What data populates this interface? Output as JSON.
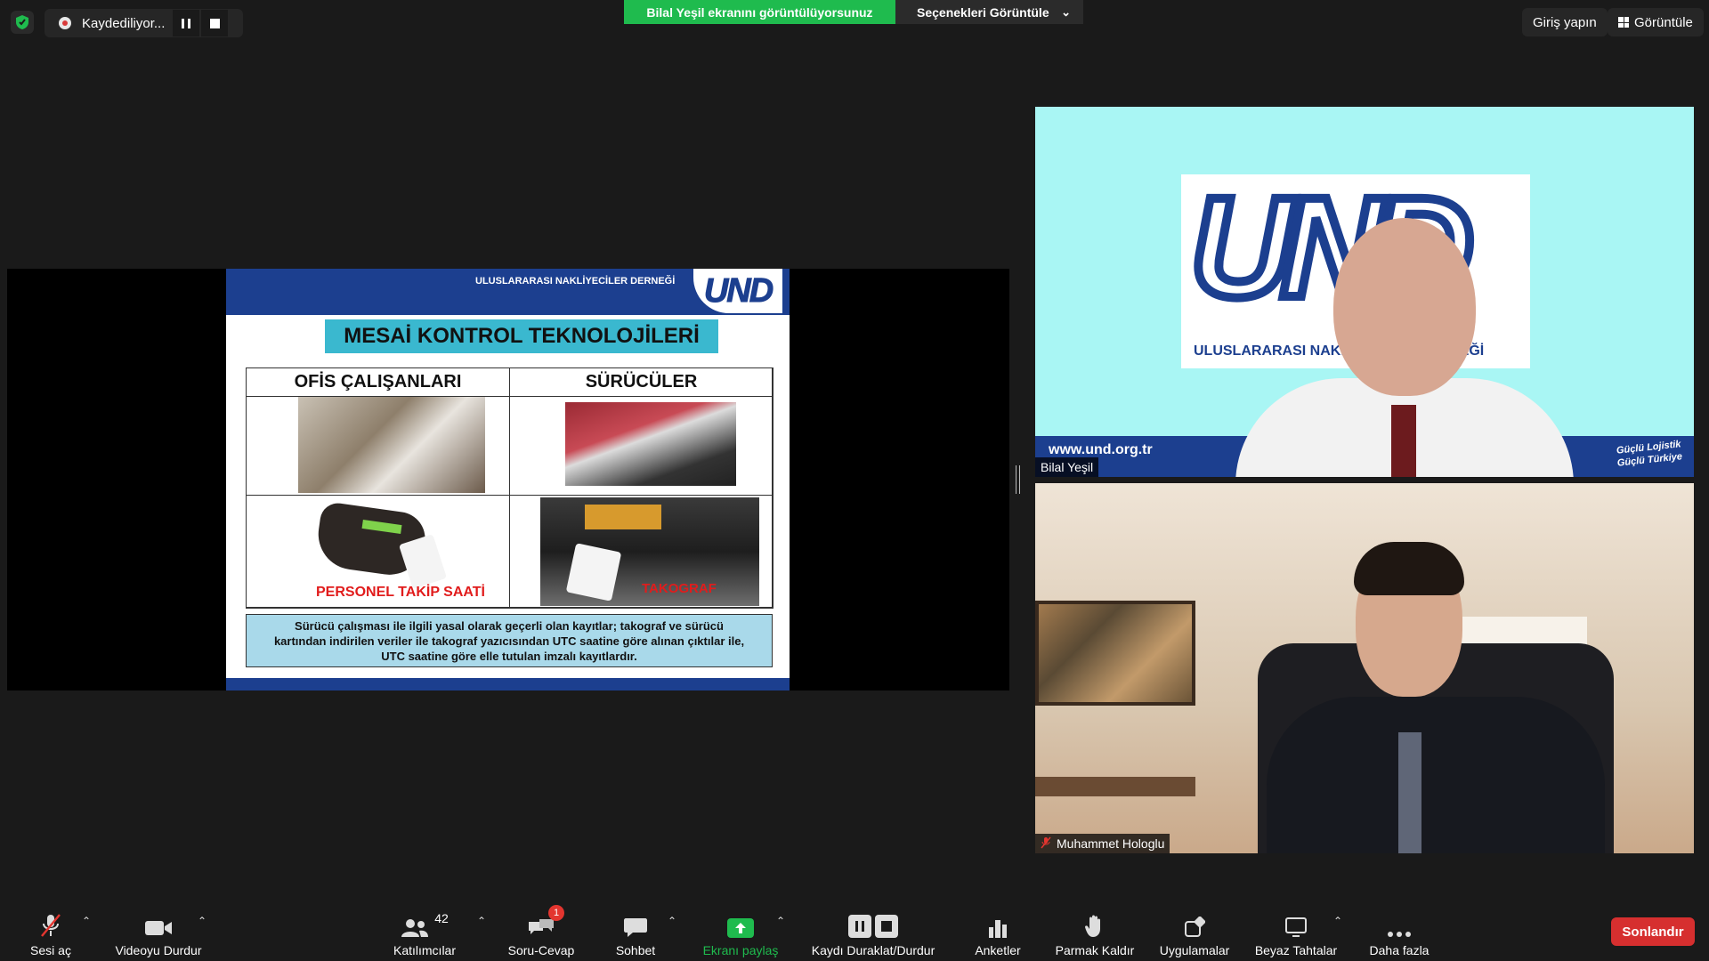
{
  "recording": {
    "status": "Kaydediliyor..."
  },
  "share_banner": {
    "text": "Bilal Yeşil ekranını görüntülüyorsunuz",
    "options": "Seçenekleri Görüntüle"
  },
  "top_right": {
    "login": "Giriş yapın",
    "view": "Görüntüle"
  },
  "slide": {
    "org_name": "ULUSLARARASI NAKLİYECİLER DERNEĞİ",
    "logo": "UND",
    "title": "MESAİ KONTROL TEKNOLOJİLERİ",
    "col1": "OFİS ÇALIŞANLARI",
    "col2": "SÜRÜCÜLER",
    "label1": "PERSONEL TAKİP SAATİ",
    "label2": "TAKOGRAF",
    "note_lines": [
      "Sürücü çalışması ile ilgili yasal olarak geçerli olan kayıtlar; takograf ve sürücü",
      "kartından indirilen veriler ile takograf yazıcısından  UTC saatine göre alınan çıktılar ile,",
      "UTC saatine göre elle tutulan imzalı  kayıtlardır."
    ]
  },
  "participants": [
    {
      "name": "Bilal Yeşil",
      "www": "www.und.org.tr",
      "background_logo": "UND",
      "org": "ULUSLARARASI NAKLİYECİLER DERNEĞİ",
      "slogan": [
        "Güçlü Lojistik",
        "Güçlü Türkiye"
      ]
    },
    {
      "name": "Muhammet Hologlu"
    }
  ],
  "toolbar": {
    "audio": "Sesi aç",
    "video": "Videoyu Durdur",
    "participants": "Katılımcılar",
    "participant_count": "42",
    "qa": "Soru-Cevap",
    "qa_badge": "1",
    "chat": "Sohbet",
    "share": "Ekranı paylaş",
    "record": "Kaydı Duraklat/Durdur",
    "polls": "Anketler",
    "raise_hand": "Parmak Kaldır",
    "apps": "Uygulamalar",
    "whiteboards": "Beyaz Tahtalar",
    "more": "Daha fazla",
    "end": "Sonlandır"
  },
  "colors": {
    "accent_green": "#1fbb4e",
    "end_red": "#d62f2f",
    "und_blue": "#1c3f8f",
    "slide_title_bg": "#3ab8cf"
  }
}
